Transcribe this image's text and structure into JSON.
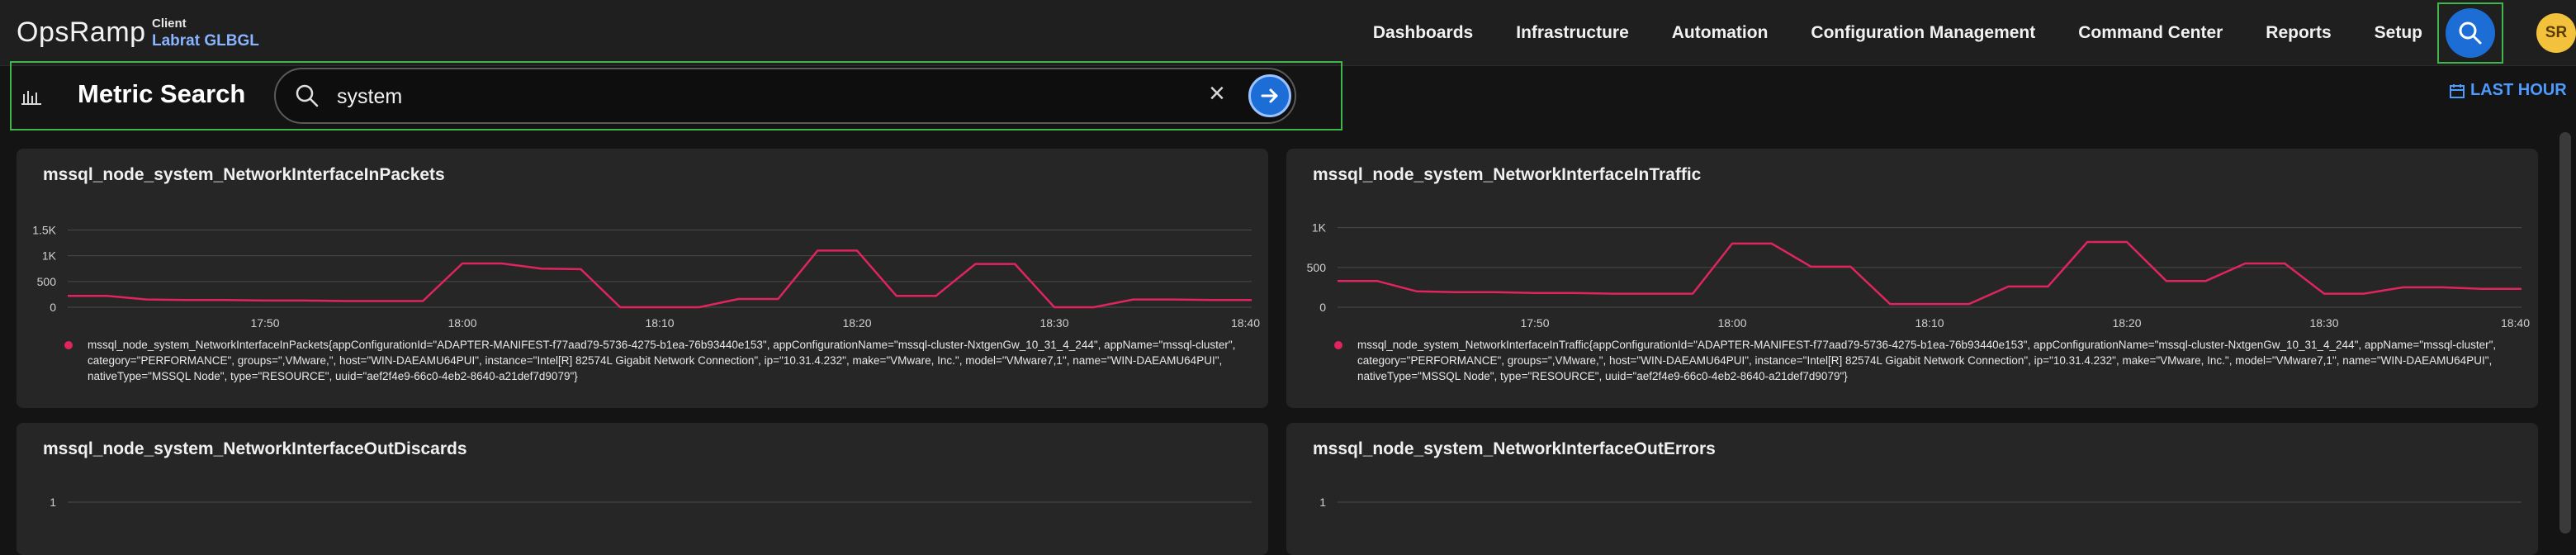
{
  "nav": {
    "logo": "OpsRamp",
    "client_label": "Client",
    "client_name": "Labrat GLBGL",
    "items": [
      "Dashboards",
      "Infrastructure",
      "Automation",
      "Configuration Management",
      "Command Center",
      "Reports",
      "Setup"
    ],
    "user_initials": "SR"
  },
  "search": {
    "title": "Metric Search",
    "query": "system",
    "time_range": "LAST HOUR"
  },
  "colors": {
    "accent": "#1c6ed6",
    "highlight": "#3fb54a",
    "series": "#e0245e",
    "avatar": "#f3c23c"
  },
  "panels": [
    {
      "title": "mssql_node_system_NetworkInterfaceInPackets",
      "legend": "mssql_node_system_NetworkInterfaceInPackets{appConfigurationId=\"ADAPTER-MANIFEST-f77aad79-5736-4275-b1ea-76b93440e153\", appConfigurationName=\"mssql-cluster-NxtgenGw_10_31_4_244\", appName=\"mssql-cluster\", category=\"PERFORMANCE\", groups=\",VMware,\", host=\"WIN-DAEAMU64PUI\", instance=\"Intel[R] 82574L Gigabit Network Connection\", ip=\"10.31.4.232\", make=\"VMware, Inc.\", model=\"VMware7,1\", name=\"WIN-DAEAMU64PUI\", nativeType=\"MSSQL Node\", type=\"RESOURCE\", uuid=\"aef2f4e9-66c0-4eb2-8640-a21def7d9079\"}"
    },
    {
      "title": "mssql_node_system_NetworkInterfaceInTraffic",
      "legend": "mssql_node_system_NetworkInterfaceInTraffic{appConfigurationId=\"ADAPTER-MANIFEST-f77aad79-5736-4275-b1ea-76b93440e153\", appConfigurationName=\"mssql-cluster-NxtgenGw_10_31_4_244\", appName=\"mssql-cluster\", category=\"PERFORMANCE\", groups=\",VMware,\", host=\"WIN-DAEAMU64PUI\", instance=\"Intel[R] 82574L Gigabit Network Connection\", ip=\"10.31.4.232\", make=\"VMware, Inc.\", model=\"VMware7,1\", name=\"WIN-DAEAMU64PUI\", nativeType=\"MSSQL Node\", type=\"RESOURCE\", uuid=\"aef2f4e9-66c0-4eb2-8640-a21def7d9079\"}"
    },
    {
      "title": "mssql_node_system_NetworkInterfaceOutDiscards"
    },
    {
      "title": "mssql_node_system_NetworkInterfaceOutErrors"
    }
  ],
  "chart_data": [
    {
      "type": "line",
      "title": "mssql_node_system_NetworkInterfaceInPackets",
      "xlim": [
        "17:40",
        "18:40"
      ],
      "xticks": [
        "17:50",
        "18:00",
        "18:10",
        "18:20",
        "18:30",
        "18:40"
      ],
      "ylim": [
        0,
        1700
      ],
      "yticks": [
        "0",
        "500",
        "1K",
        "1.5K"
      ],
      "series": [
        {
          "x": [
            "17:40",
            "17:42",
            "17:44",
            "17:46",
            "17:48",
            "17:50",
            "17:52",
            "17:54",
            "17:56",
            "17:58",
            "18:00",
            "18:02",
            "18:04",
            "18:06",
            "18:08",
            "18:10",
            "18:12",
            "18:14",
            "18:16",
            "18:18",
            "18:20",
            "18:22",
            "18:24",
            "18:26",
            "18:28",
            "18:30",
            "18:32",
            "18:34",
            "18:36",
            "18:38",
            "18:40"
          ],
          "y": [
            220,
            220,
            150,
            140,
            140,
            130,
            130,
            120,
            120,
            120,
            850,
            850,
            750,
            740,
            0,
            0,
            0,
            160,
            160,
            1100,
            1100,
            220,
            220,
            840,
            840,
            0,
            0,
            150,
            150,
            140,
            140
          ]
        }
      ]
    },
    {
      "type": "line",
      "title": "mssql_node_system_NetworkInterfaceInTraffic",
      "xlim": [
        "17:40",
        "18:40"
      ],
      "xticks": [
        "17:50",
        "18:00",
        "18:10",
        "18:20",
        "18:30",
        "18:40"
      ],
      "ylim": [
        0,
        1100
      ],
      "yticks": [
        "0",
        "500",
        "1K"
      ],
      "series": [
        {
          "x": [
            "17:40",
            "17:42",
            "17:44",
            "17:46",
            "17:48",
            "17:50",
            "17:52",
            "17:54",
            "17:56",
            "17:58",
            "18:00",
            "18:02",
            "18:04",
            "18:06",
            "18:08",
            "18:10",
            "18:12",
            "18:14",
            "18:16",
            "18:18",
            "18:20",
            "18:22",
            "18:24",
            "18:26",
            "18:28",
            "18:30",
            "18:32",
            "18:34",
            "18:36",
            "18:38",
            "18:40"
          ],
          "y": [
            330,
            330,
            200,
            190,
            190,
            180,
            180,
            170,
            170,
            170,
            800,
            800,
            510,
            510,
            40,
            40,
            40,
            260,
            260,
            820,
            820,
            330,
            330,
            550,
            550,
            170,
            170,
            250,
            250,
            230,
            230
          ]
        }
      ]
    },
    {
      "type": "line",
      "title": "mssql_node_system_NetworkInterfaceOutDiscards",
      "yticks": [
        "1"
      ],
      "series": []
    },
    {
      "type": "line",
      "title": "mssql_node_system_NetworkInterfaceOutErrors",
      "yticks": [
        "1"
      ],
      "series": []
    }
  ]
}
